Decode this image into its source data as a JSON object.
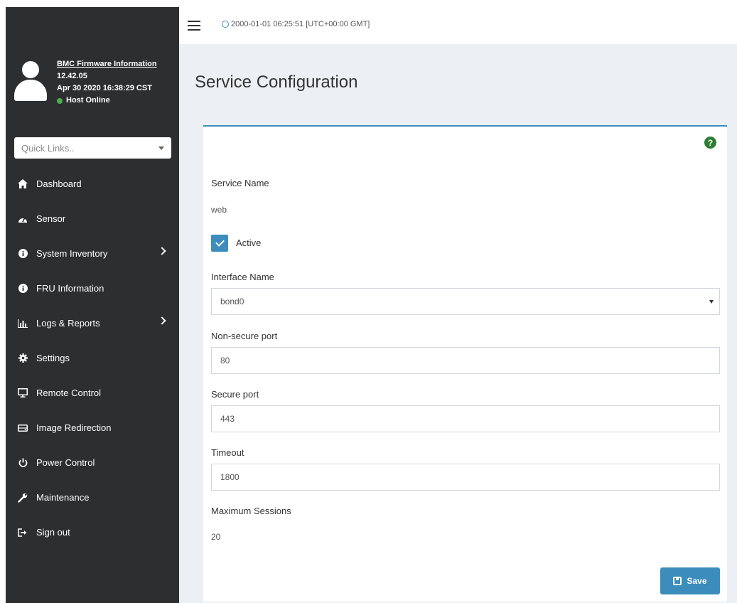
{
  "header": {
    "datetime": "2000-01-01 06:25:51 [UTC+00:00 GMT]"
  },
  "user_panel": {
    "firmware_title": "BMC Firmware Information",
    "version": "12.42.05",
    "build_date": "Apr 30 2020 16:38:29 CST",
    "host_status": "Host Online"
  },
  "quick_links": {
    "placeholder": "Quick Links.."
  },
  "sidebar": {
    "items": [
      {
        "label": "Dashboard",
        "icon": "home-icon"
      },
      {
        "label": "Sensor",
        "icon": "dashboard-gauge-icon"
      },
      {
        "label": "System Inventory",
        "icon": "info-circle-icon",
        "has_submenu": true
      },
      {
        "label": "FRU Information",
        "icon": "info-circle-icon"
      },
      {
        "label": "Logs & Reports",
        "icon": "bar-chart-icon",
        "has_submenu": true
      },
      {
        "label": "Settings",
        "icon": "gear-icon"
      },
      {
        "label": "Remote Control",
        "icon": "monitor-icon"
      },
      {
        "label": "Image Redirection",
        "icon": "hdd-icon"
      },
      {
        "label": "Power Control",
        "icon": "power-icon"
      },
      {
        "label": "Maintenance",
        "icon": "wrench-icon"
      },
      {
        "label": "Sign out",
        "icon": "sign-out-icon"
      }
    ]
  },
  "page": {
    "title": "Service Configuration"
  },
  "form": {
    "service_name_label": "Service Name",
    "service_name_value": "web",
    "active_label": "Active",
    "active_checked": true,
    "interface_label": "Interface Name",
    "interface_value": "bond0",
    "nonsecure_label": "Non-secure port",
    "nonsecure_value": "80",
    "secure_label": "Secure port",
    "secure_value": "443",
    "timeout_label": "Timeout",
    "timeout_value": "1800",
    "max_sessions_label": "Maximum Sessions",
    "max_sessions_value": "20",
    "save_label": "Save"
  },
  "colors": {
    "sidebar_bg": "#2c2e30",
    "accent": "#3c8dbc",
    "status_green": "#4cae4c",
    "content_bg": "#ecf0f5"
  }
}
